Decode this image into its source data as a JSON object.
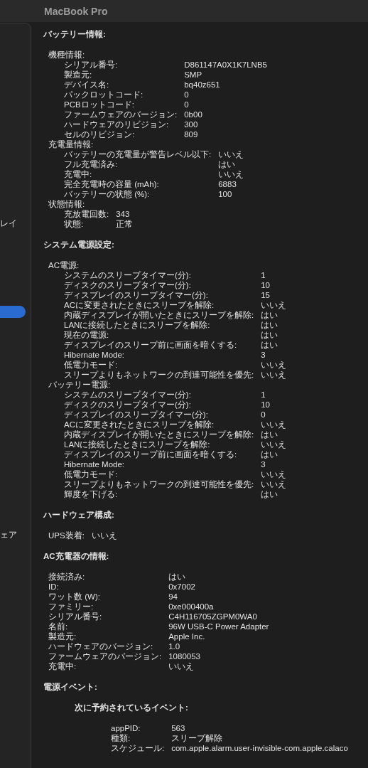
{
  "window": {
    "title": "MacBook Pro"
  },
  "sidebar": {
    "items": [
      {
        "label": "レイ",
        "selected": false
      },
      {
        "selected": true
      },
      {
        "label": "ェア",
        "selected": false
      }
    ]
  },
  "sections": [
    {
      "title": "バッテリー情報:",
      "children": [
        {
          "kind": "group",
          "label": "機種情報:",
          "children": [
            {
              "kind": "row",
              "label": "シリアル番号:",
              "value": "D861147A0X1K7LNB5"
            },
            {
              "kind": "row",
              "label": "製造元:",
              "value": "SMP"
            },
            {
              "kind": "row",
              "label": "デバイス名:",
              "value": "bq40z651"
            },
            {
              "kind": "row",
              "label": "パックロットコード:",
              "value": "0"
            },
            {
              "kind": "row",
              "label": "PCBロットコード:",
              "value": "0"
            },
            {
              "kind": "row",
              "label": "ファームウェアのバージョン:",
              "value": "0b00"
            },
            {
              "kind": "row",
              "label": "ハードウェアのリビジョン:",
              "value": "300"
            },
            {
              "kind": "row",
              "label": "セルのリビジョン:",
              "value": "809"
            }
          ]
        },
        {
          "kind": "group",
          "label": "充電量情報:",
          "children": [
            {
              "kind": "row",
              "label": "バッテリーの充電量が警告レベル以下:",
              "value": "いいえ"
            },
            {
              "kind": "row",
              "label": "フル充電済み:",
              "value": "はい"
            },
            {
              "kind": "row",
              "label": "充電中:",
              "value": "いいえ"
            },
            {
              "kind": "row",
              "label": "完全充電時の容量 (mAh):",
              "value": "6883"
            },
            {
              "kind": "row",
              "label": "バッテリーの状態 (%):",
              "value": "100"
            }
          ]
        },
        {
          "kind": "group",
          "label": "状態情報:",
          "children": [
            {
              "kind": "row",
              "label": "充放電回数:",
              "value": "343"
            },
            {
              "kind": "row",
              "label": "状態:",
              "value": "正常"
            }
          ]
        }
      ]
    },
    {
      "title": "システム電源設定:",
      "children": [
        {
          "kind": "group",
          "label": "AC電源:",
          "children": [
            {
              "kind": "row",
              "label": "システムのスリープタイマー(分):",
              "value": "1"
            },
            {
              "kind": "row",
              "label": "ディスクのスリープタイマー(分):",
              "value": "10"
            },
            {
              "kind": "row",
              "label": "ディスプレイのスリープタイマー(分):",
              "value": "15"
            },
            {
              "kind": "row",
              "label": "ACに変更されたときにスリープを解除:",
              "value": "いいえ"
            },
            {
              "kind": "row",
              "label": "内蔵ディスプレイが開いたときにスリープを解除:",
              "value": "はい"
            },
            {
              "kind": "row",
              "label": "LANに接続したときにスリープを解除:",
              "value": "はい"
            },
            {
              "kind": "row",
              "label": "現在の電源:",
              "value": "はい"
            },
            {
              "kind": "row",
              "label": "ディスプレイのスリープ前に画面を暗くする:",
              "value": "はい"
            },
            {
              "kind": "row",
              "label": "Hibernate Mode:",
              "value": "3"
            },
            {
              "kind": "row",
              "label": "低電力モード:",
              "value": "いいえ"
            },
            {
              "kind": "row",
              "label": "スリープよりもネットワークの到達可能性を優先:",
              "value": "いいえ"
            }
          ]
        },
        {
          "kind": "group",
          "label": "バッテリー電源:",
          "children": [
            {
              "kind": "row",
              "label": "システムのスリープタイマー(分):",
              "value": "1"
            },
            {
              "kind": "row",
              "label": "ディスクのスリープタイマー(分):",
              "value": "10"
            },
            {
              "kind": "row",
              "label": "ディスプレイのスリープタイマー(分):",
              "value": "0"
            },
            {
              "kind": "row",
              "label": "ACに変更されたときにスリープを解除:",
              "value": "いいえ"
            },
            {
              "kind": "row",
              "label": "内蔵ディスプレイが開いたときにスリープを解除:",
              "value": "はい"
            },
            {
              "kind": "row",
              "label": "LANに接続したときにスリープを解除:",
              "value": "いいえ"
            },
            {
              "kind": "row",
              "label": "ディスプレイのスリープ前に画面を暗くする:",
              "value": "はい"
            },
            {
              "kind": "row",
              "label": "Hibernate Mode:",
              "value": "3"
            },
            {
              "kind": "row",
              "label": "低電力モード:",
              "value": "いいえ"
            },
            {
              "kind": "row",
              "label": "スリープよりもネットワークの到達可能性を優先:",
              "value": "いいえ"
            },
            {
              "kind": "row",
              "label": "輝度を下げる:",
              "value": "はい"
            }
          ]
        }
      ]
    },
    {
      "title": "ハードウェア構成:",
      "children": [
        {
          "kind": "row",
          "label": "UPS装着:",
          "value": "いいえ"
        }
      ]
    },
    {
      "title": "AC充電器の情報:",
      "children": [
        {
          "kind": "row",
          "label": "接続済み:",
          "value": "はい"
        },
        {
          "kind": "row",
          "label": "ID:",
          "value": "0x7002"
        },
        {
          "kind": "row",
          "label": "ワット数 (W):",
          "value": "94"
        },
        {
          "kind": "row",
          "label": "ファミリー:",
          "value": "0xe000400a"
        },
        {
          "kind": "row",
          "label": "シリアル番号:",
          "value": "C4H116705ZGPM0WA0"
        },
        {
          "kind": "row",
          "label": "名前:",
          "value": "96W USB-C Power Adapter"
        },
        {
          "kind": "row",
          "label": "製造元:",
          "value": "Apple Inc."
        },
        {
          "kind": "row",
          "label": "ハードウェアのバージョン:",
          "value": "1.0"
        },
        {
          "kind": "row",
          "label": "ファームウェアのバージョン:",
          "value": "1080053"
        },
        {
          "kind": "row",
          "label": "充電中:",
          "value": "いいえ"
        }
      ]
    },
    {
      "title": "電源イベント:",
      "children": [
        {
          "kind": "event",
          "label": "次に予約されているイベント:",
          "children": [
            {
              "kind": "row",
              "label": "appPID:",
              "value": "563"
            },
            {
              "kind": "row",
              "label": "種類:",
              "value": "スリープ解除"
            },
            {
              "kind": "row",
              "label": "スケジュール:",
              "value": "com.apple.alarm.user-invisible-com.apple.calaco"
            }
          ]
        }
      ]
    }
  ]
}
